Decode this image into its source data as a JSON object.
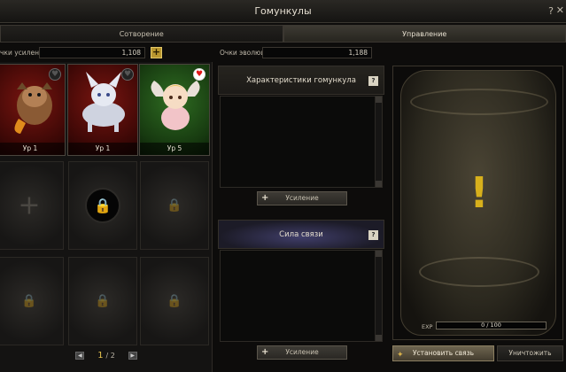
{
  "window": {
    "title": "Гомункулы",
    "help": "?",
    "close": "✕"
  },
  "tabs": [
    {
      "label": "Сотворение",
      "active": false
    },
    {
      "label": "Управление",
      "active": true
    }
  ],
  "points": {
    "enhance_label": "чки усиления",
    "enhance_value": "1,108",
    "evolution_label": "Очки эволюции",
    "evolution_value": "1,188"
  },
  "pets": [
    {
      "level": "Ур 1",
      "theme": "red",
      "favorite": false,
      "heart": "♥",
      "icon": "dragon-pet-portrait"
    },
    {
      "level": "Ур 1",
      "theme": "red",
      "favorite": false,
      "heart": "♥",
      "icon": "white-wolf-pet-portrait"
    },
    {
      "level": "Ур 5",
      "theme": "green",
      "favorite": true,
      "heart": "♥",
      "icon": "angel-doll-pet-portrait"
    }
  ],
  "slots": {
    "add_symbol": "+",
    "lock_symbol": "🔒"
  },
  "pager": {
    "current": "1",
    "total": "/ 2",
    "prev": "◀",
    "next": "▶"
  },
  "characteristics": {
    "title": "Характеристики гомункула",
    "help": "?",
    "button": "Усиление",
    "button_icon": "+"
  },
  "bond": {
    "title": "Сила связи",
    "help": "?",
    "button": "Усиление",
    "button_icon": "+"
  },
  "jar": {
    "symbol": "!",
    "exp_label": "EXP",
    "exp_value": "0 / 100",
    "exp_fraction": 0
  },
  "actions": {
    "link": "Установить связь",
    "link_icon": "✦",
    "destroy": "Уничтожить"
  },
  "colors": {
    "accent_gold": "#d7b01c",
    "favorite_heart": "#e01818"
  }
}
